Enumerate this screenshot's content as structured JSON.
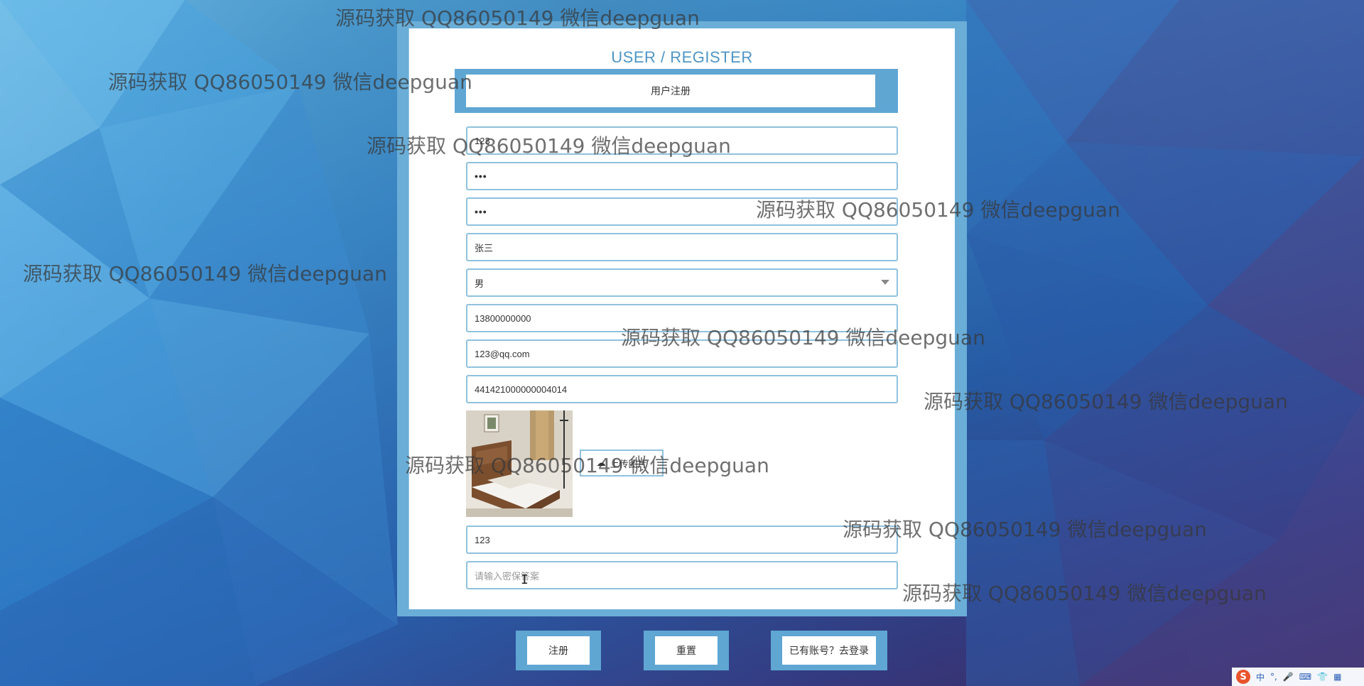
{
  "form": {
    "title": "USER / REGISTER",
    "section_header": "用户注册",
    "fields": [
      {
        "name": "username",
        "value": "123",
        "placeholder": ""
      },
      {
        "name": "password",
        "value": "•••",
        "placeholder": ""
      },
      {
        "name": "confirm-password",
        "value": "•••",
        "placeholder": ""
      },
      {
        "name": "real-name",
        "value": "张三",
        "placeholder": ""
      },
      {
        "name": "gender",
        "value": "男",
        "placeholder": ""
      },
      {
        "name": "phone",
        "value": "13800000000",
        "placeholder": ""
      },
      {
        "name": "email",
        "value": "123@qq.com",
        "placeholder": ""
      },
      {
        "name": "id-card",
        "value": "441421000000004014",
        "placeholder": ""
      },
      {
        "name": "security-question",
        "value": "123",
        "placeholder": ""
      },
      {
        "name": "security-answer",
        "value": "",
        "placeholder": "请输入密保答案"
      }
    ],
    "upload_label": "上传图片"
  },
  "buttons": {
    "register": "注册",
    "reset": "重置",
    "go_login": "已有账号？去登录"
  },
  "watermark_text": "源码获取 QQ86050149 微信deepguan",
  "tray": {
    "logo": "S",
    "ime_mode": "中"
  },
  "colors": {
    "panel_frame": "#6aaed8",
    "title": "#4f95c5",
    "field_border": "#8fc1de"
  }
}
